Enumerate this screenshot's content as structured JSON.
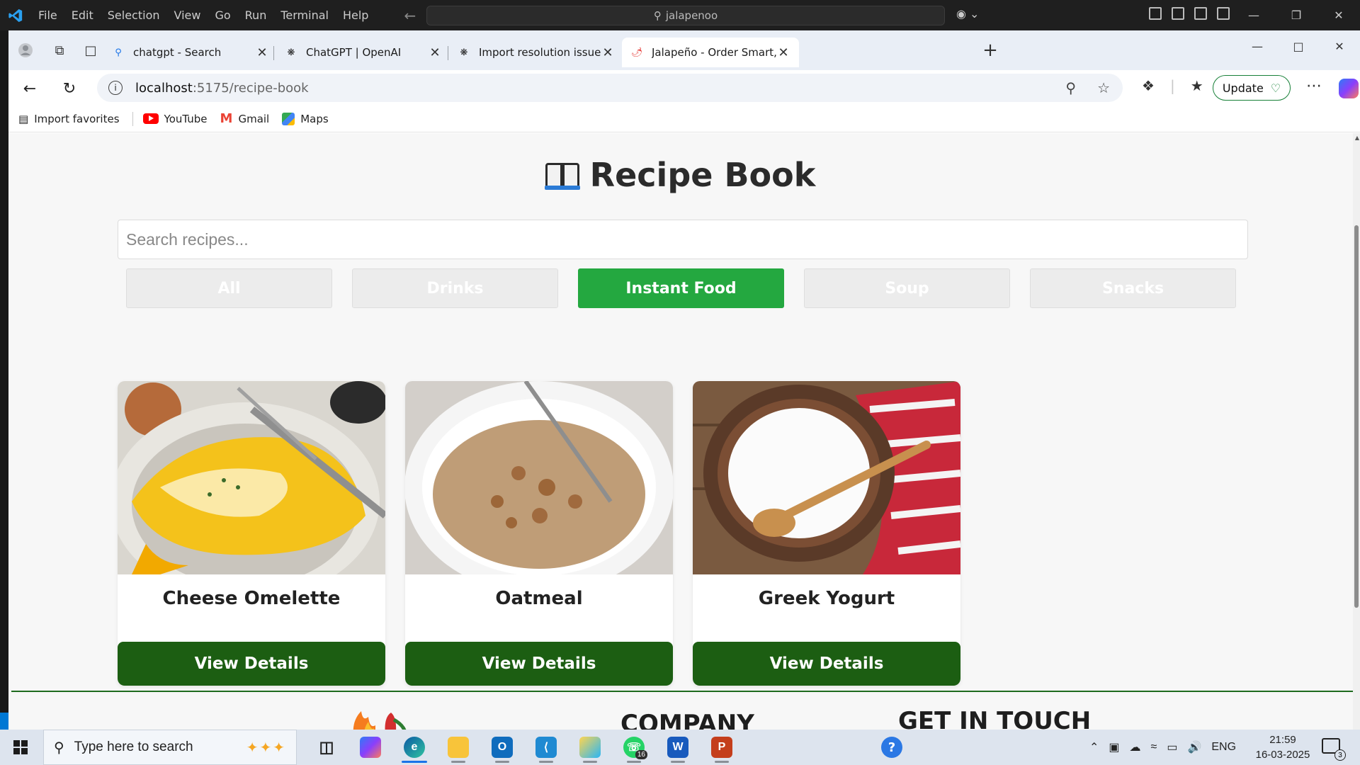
{
  "vscode": {
    "menu": [
      "File",
      "Edit",
      "Selection",
      "View",
      "Go",
      "Run",
      "Terminal",
      "Help"
    ],
    "search_text": "jalapenoo"
  },
  "browser": {
    "tabs": [
      {
        "title": "chatgpt - Search",
        "icon": "search-icon"
      },
      {
        "title": "ChatGPT | OpenAI",
        "icon": "openai-icon"
      },
      {
        "title": "Import resolution issue",
        "icon": "openai-icon"
      },
      {
        "title": "Jalapeño - Order Smart, Eat Healthy",
        "icon": "chili-icon",
        "active": true
      }
    ],
    "url_host": "localhost",
    "url_path": ":5175/recipe-book",
    "update_label": "Update",
    "favorites": [
      {
        "label": "Import favorites",
        "icon": "import-favorites-icon"
      },
      {
        "label": "YouTube",
        "icon": "youtube-icon"
      },
      {
        "label": "Gmail",
        "icon": "gmail-icon"
      },
      {
        "label": "Maps",
        "icon": "maps-icon"
      }
    ]
  },
  "page": {
    "title": "Recipe Book",
    "search_placeholder": "Search recipes...",
    "categories": [
      {
        "label": "All",
        "active": false
      },
      {
        "label": "Drinks",
        "active": false
      },
      {
        "label": "Instant Food",
        "active": true
      },
      {
        "label": "Soup",
        "active": false
      },
      {
        "label": "Snacks",
        "active": false
      }
    ],
    "recipes": [
      {
        "name": "Cheese Omelette",
        "button": "View Details",
        "image": "omelette-image"
      },
      {
        "name": "Oatmeal",
        "button": "View Details",
        "image": "oatmeal-image"
      },
      {
        "name": "Greek Yogurt",
        "button": "View Details",
        "image": "yogurt-image"
      }
    ],
    "footer": {
      "company_heading": "COMPANY",
      "contact_heading": "GET IN TOUCH"
    }
  },
  "taskbar": {
    "search_placeholder": "Type here to search",
    "whatsapp_badge": "16",
    "language": "ENG",
    "time": "21:59",
    "date": "16-03-2025",
    "notification_count": "3"
  },
  "colors": {
    "active_category": "#24a840",
    "view_details_button": "#1c5e12",
    "footer_line": "#1f6b1f"
  }
}
